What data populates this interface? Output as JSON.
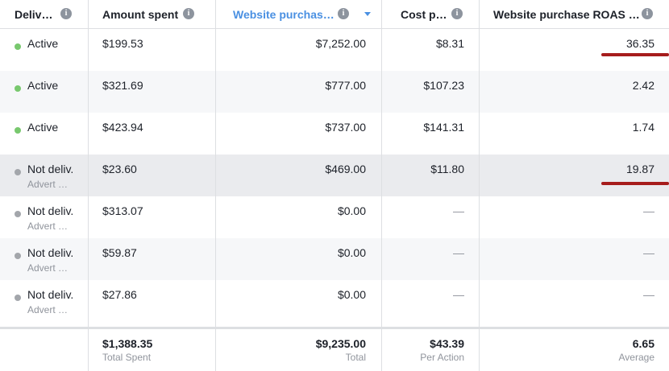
{
  "columns": {
    "delivery": "Deliv…",
    "amount_spent": "Amount spent",
    "website_purchases": "Website purchas…",
    "cost_per": "Cost p…",
    "roas": "Website purchase ROAS …"
  },
  "colors": {
    "active": "#78c86e",
    "inactive": "#a3a6ab",
    "sorted": "#4a90e2",
    "annotation": "#a61c1c"
  },
  "rows": [
    {
      "status": "Active",
      "sub": "",
      "amount": "$199.53",
      "purchases": "$7,252.00",
      "cost": "$8.31",
      "roas": "36.35"
    },
    {
      "status": "Active",
      "sub": "",
      "amount": "$321.69",
      "purchases": "$777.00",
      "cost": "$107.23",
      "roas": "2.42"
    },
    {
      "status": "Active",
      "sub": "",
      "amount": "$423.94",
      "purchases": "$737.00",
      "cost": "$141.31",
      "roas": "1.74"
    },
    {
      "status": "Not deliv.",
      "sub": "Advert …",
      "amount": "$23.60",
      "purchases": "$469.00",
      "cost": "$11.80",
      "roas": "19.87"
    },
    {
      "status": "Not deliv.",
      "sub": "Advert …",
      "amount": "$313.07",
      "purchases": "$0.00",
      "cost": "—",
      "roas": "—"
    },
    {
      "status": "Not deliv.",
      "sub": "Advert …",
      "amount": "$59.87",
      "purchases": "$0.00",
      "cost": "—",
      "roas": "—"
    },
    {
      "status": "Not deliv.",
      "sub": "Advert …",
      "amount": "$27.86",
      "purchases": "$0.00",
      "cost": "—",
      "roas": "—"
    }
  ],
  "summary": {
    "amount": {
      "value": "$1,388.35",
      "label": "Total Spent"
    },
    "purchases": {
      "value": "$9,235.00",
      "label": "Total"
    },
    "cost": {
      "value": "$43.39",
      "label": "Per Action"
    },
    "roas": {
      "value": "6.65",
      "label": "Average"
    }
  },
  "icons": {
    "info": "info-icon",
    "sort": "sort-descending-icon"
  }
}
